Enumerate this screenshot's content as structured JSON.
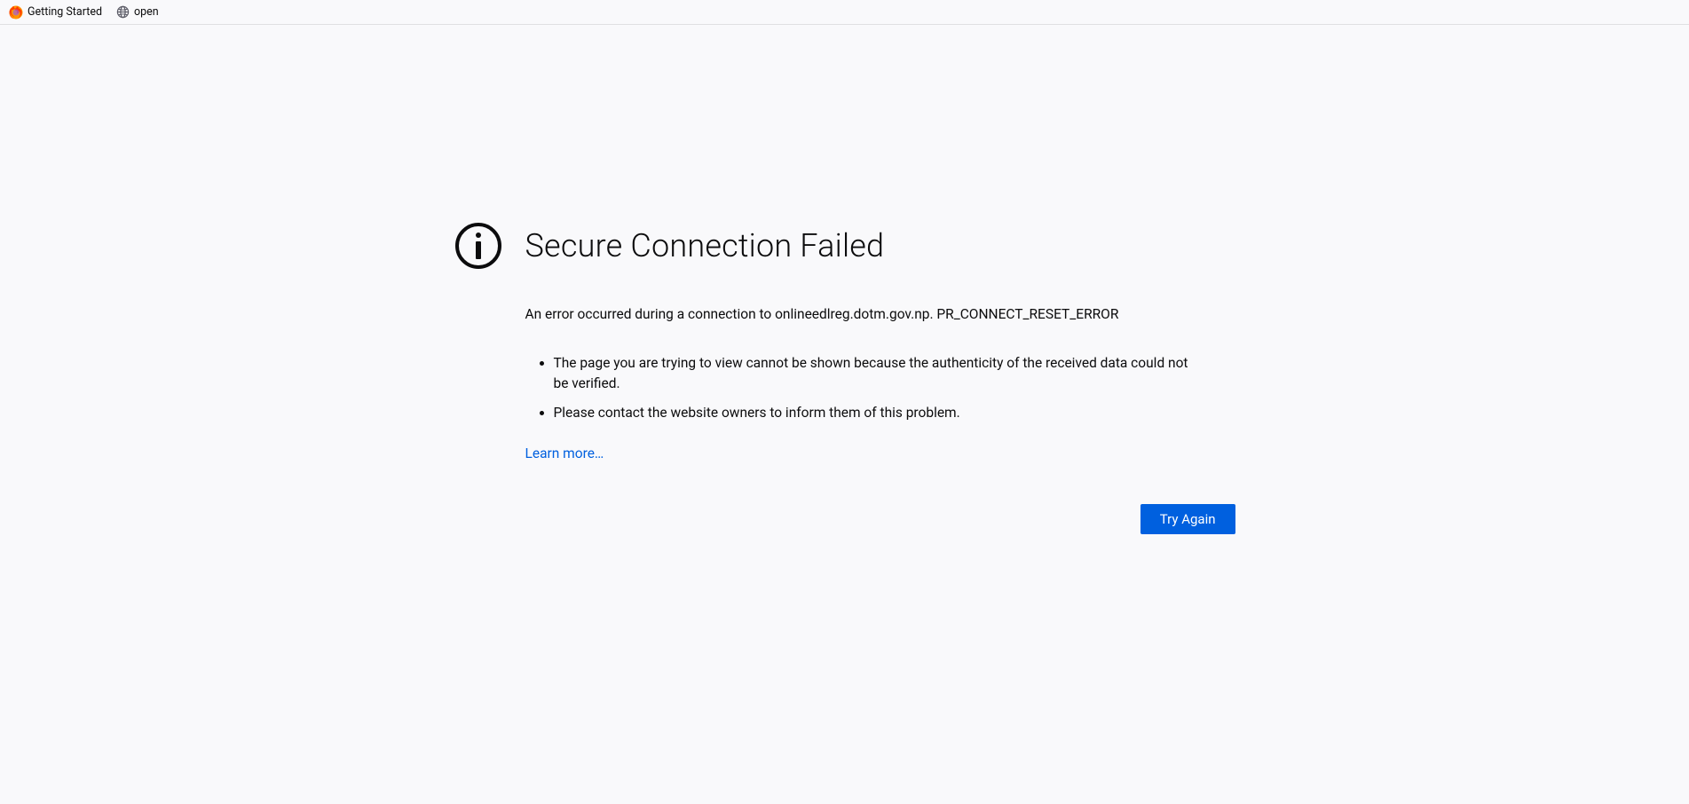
{
  "bookmarks": {
    "items": [
      {
        "label": "Getting Started"
      },
      {
        "label": "open"
      }
    ]
  },
  "error": {
    "title": "Secure Connection Failed",
    "description": "An error occurred during a connection to onlineedlreg.dotm.gov.np. PR_CONNECT_RESET_ERROR",
    "bullets": [
      "The page you are trying to view cannot be shown because the authenticity of the received data could not be verified.",
      "Please contact the website owners to inform them of this problem."
    ],
    "learn_more": "Learn more…",
    "try_again": "Try Again"
  }
}
